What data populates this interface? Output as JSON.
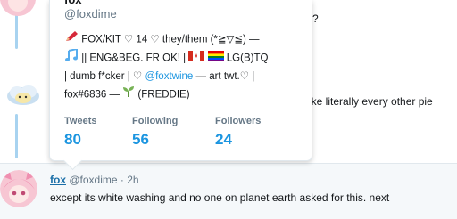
{
  "background": {
    "line1_fragment": "?",
    "line2_fragment": "ike literally every other pie"
  },
  "hovercard": {
    "name": "fox",
    "handle": "@foxdime",
    "bio_line1": "FOX/KIT ♡ 14 ♡ they/them (*≧▽≦) —",
    "bio_line2": "|| ENG&BEG. FR OK! |",
    "bio_line2_tail": "LG(B)TQ",
    "bio_line3_a": "| dumb f*cker | ♡",
    "bio_line3_link": "@foxtwine",
    "bio_line3_b": "— art twt.♡ |",
    "bio_line4_a": "fox#6836 —",
    "bio_line4_b": "(FREDDIE)",
    "stats": [
      {
        "label": "Tweets",
        "value": "80"
      },
      {
        "label": "Following",
        "value": "56"
      },
      {
        "label": "Followers",
        "value": "24"
      }
    ]
  },
  "reply": {
    "name": "fox",
    "handle": "@foxdime",
    "separator": "·",
    "time": "2h",
    "text": "except its white washing and no one on planet earth asked for this. next"
  },
  "icons": [
    "pencil-icon",
    "music-notes-icon",
    "canada-flag-icon",
    "rainbow-flag-icon",
    "seedling-icon"
  ],
  "colors": {
    "link": "#1b95e0",
    "name_link": "#1b6fa8",
    "thread": "#a8d3f0",
    "reply_bg": "#f5f8fa"
  }
}
